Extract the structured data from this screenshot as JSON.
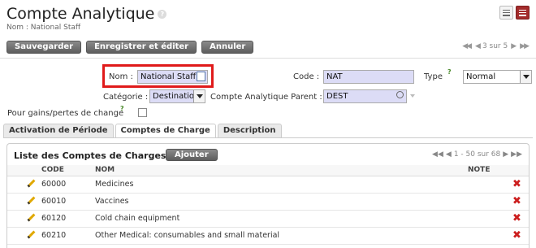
{
  "header": {
    "title": "Compte Analytique",
    "help_glyph": "?",
    "breadcrumb": "Nom : National Staff"
  },
  "toolbar": {
    "save_label": "Sauvegarder",
    "save_edit_label": "Enregistrer et éditer",
    "cancel_label": "Annuler"
  },
  "pager": {
    "first": "◀◀",
    "prev": "◀",
    "text": "3 sur 5",
    "next": "▶",
    "last": "▶▶"
  },
  "form": {
    "name_label": "Nom :",
    "name_value": "National Staff",
    "code_label": "Code :",
    "code_value": "NAT",
    "type_label": "Type",
    "type_value": "Normal",
    "category_label": "Catégorie :",
    "category_value": "Destination",
    "parent_label": "Compte Analytique Parent :",
    "parent_value": "DEST",
    "gains_label": "Pour gains/pertes de change",
    "help_mark": "?",
    "gains_checked": false
  },
  "tabs": [
    {
      "label": "Activation de Période"
    },
    {
      "label": "Comptes de Charge"
    },
    {
      "label": "Description"
    }
  ],
  "active_tab": "Comptes de Charge",
  "list": {
    "title": "Liste des Comptes de Charges",
    "add_label": "Ajouter",
    "pager_text": "1 - 50 sur 68",
    "columns": {
      "code": "CODE",
      "name": "NOM",
      "note": "NOTE"
    },
    "rows": [
      {
        "code": "60000",
        "name": "Medicines",
        "note": ""
      },
      {
        "code": "60010",
        "name": "Vaccines",
        "note": ""
      },
      {
        "code": "60120",
        "name": "Cold chain equipment",
        "note": ""
      },
      {
        "code": "60210",
        "name": "Other Medical: consumables and small material",
        "note": ""
      }
    ]
  },
  "colors": {
    "highlight": "#e01a1a",
    "field_bg": "#dcdcf6",
    "accent_view": "#a32b2b",
    "delete": "#cc1f1f"
  },
  "icons": {
    "list_view": "list-view-icon",
    "form_view": "form-view-icon",
    "edit": "pencil-icon",
    "delete": "delete-x-icon",
    "search": "search-icon"
  }
}
